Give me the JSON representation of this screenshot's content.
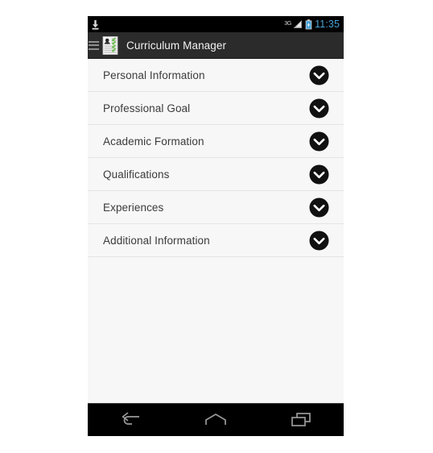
{
  "status_bar": {
    "download_icon": "download-icon",
    "network_label": "3G",
    "signal_icon": "signal-bars-icon",
    "battery_icon": "battery-charging-icon",
    "time": "11:35"
  },
  "action_bar": {
    "menu_icon": "hamburger-menu-icon",
    "app_icon": "curriculum-document-icon",
    "title": "Curriculum Manager"
  },
  "list": {
    "expand_icon": "chevron-down-circle-icon",
    "items": [
      {
        "label": "Personal Information"
      },
      {
        "label": "Professional Goal"
      },
      {
        "label": "Academic Formation"
      },
      {
        "label": "Qualifications"
      },
      {
        "label": "Experiences"
      },
      {
        "label": "Additional Information"
      }
    ]
  },
  "nav_bar": {
    "back_label": "Back",
    "home_label": "Home",
    "recents_label": "Recent apps"
  },
  "colors": {
    "status_bar_bg": "#000000",
    "action_bar_bg": "#2b2b2b",
    "screen_bg": "#f7f7f7",
    "row_text": "#3b3b3b",
    "divider": "#e4e4e4",
    "clock_blue": "#49a3d6",
    "accent_green": "#6abf4b",
    "nav_icon": "#9a9a9a"
  }
}
